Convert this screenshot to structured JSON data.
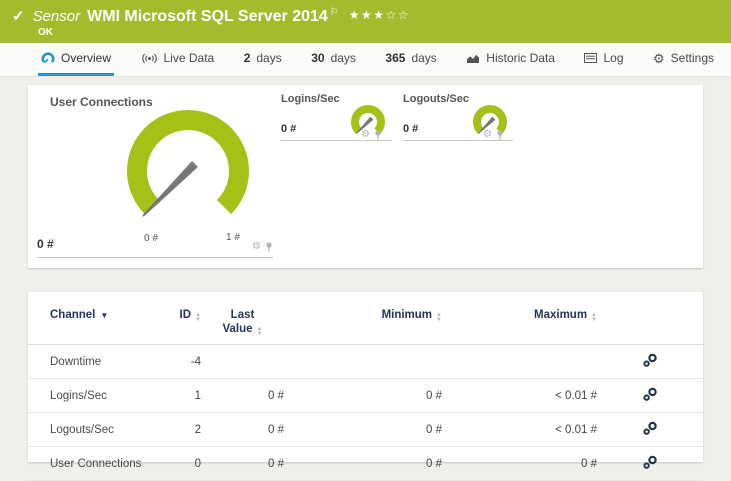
{
  "header": {
    "check_glyph": "✓",
    "kind": "Sensor",
    "title": "WMI Microsoft SQL Server 2014",
    "flag_glyph": "⚐",
    "stars_filled": "★★★",
    "stars_empty": "☆☆",
    "status": "OK",
    "bar_color": "#a6ba2e"
  },
  "tabs": {
    "overview": {
      "label": "Overview"
    },
    "live_data": {
      "label": "Live Data"
    },
    "days2": {
      "num": "2",
      "unit": "days"
    },
    "days30": {
      "num": "30",
      "unit": "days"
    },
    "days365": {
      "num": "365",
      "unit": "days"
    },
    "historic": {
      "label": "Historic Data"
    },
    "log": {
      "label": "Log"
    },
    "settings": {
      "label": "Settings"
    }
  },
  "gauges": {
    "main": {
      "title": "User Connections",
      "last_value": "0 #",
      "scale_min_label": "0 #",
      "scale_max_label": "1 #",
      "value": 0,
      "range_min": 0,
      "range_max": 1
    },
    "mini": [
      {
        "title": "Logins/Sec",
        "last_value": "0 #",
        "value": 0
      },
      {
        "title": "Logouts/Sec",
        "last_value": "0 #",
        "value": 0
      }
    ],
    "gauge_color": "#a3c117",
    "needle_color": "#777777"
  },
  "icons": {
    "settings_gear": "⚙",
    "gauge_gear": "⚙",
    "sort_asc": "▲",
    "sort_desc": "▼",
    "sorted_desc": "▼"
  },
  "table": {
    "headers": {
      "channel": "Channel",
      "id": "ID",
      "last_line1": "Last",
      "last_line2": "Value",
      "minimum": "Minimum",
      "maximum": "Maximum"
    },
    "rows": [
      {
        "channel": "Downtime",
        "id": "-4",
        "last": "",
        "min": "",
        "max": ""
      },
      {
        "channel": "Logins/Sec",
        "id": "1",
        "last": "0 #",
        "min": "0 #",
        "max": "< 0.01 #"
      },
      {
        "channel": "Logouts/Sec",
        "id": "2",
        "last": "0 #",
        "min": "0 #",
        "max": "< 0.01 #"
      },
      {
        "channel": "User Connections",
        "id": "0",
        "last": "0 #",
        "min": "0 #",
        "max": "0 #"
      }
    ]
  },
  "colors": {
    "accent_blue": "#2196d4",
    "panel_bg": "#ffffff",
    "page_bg": "#efefec"
  }
}
